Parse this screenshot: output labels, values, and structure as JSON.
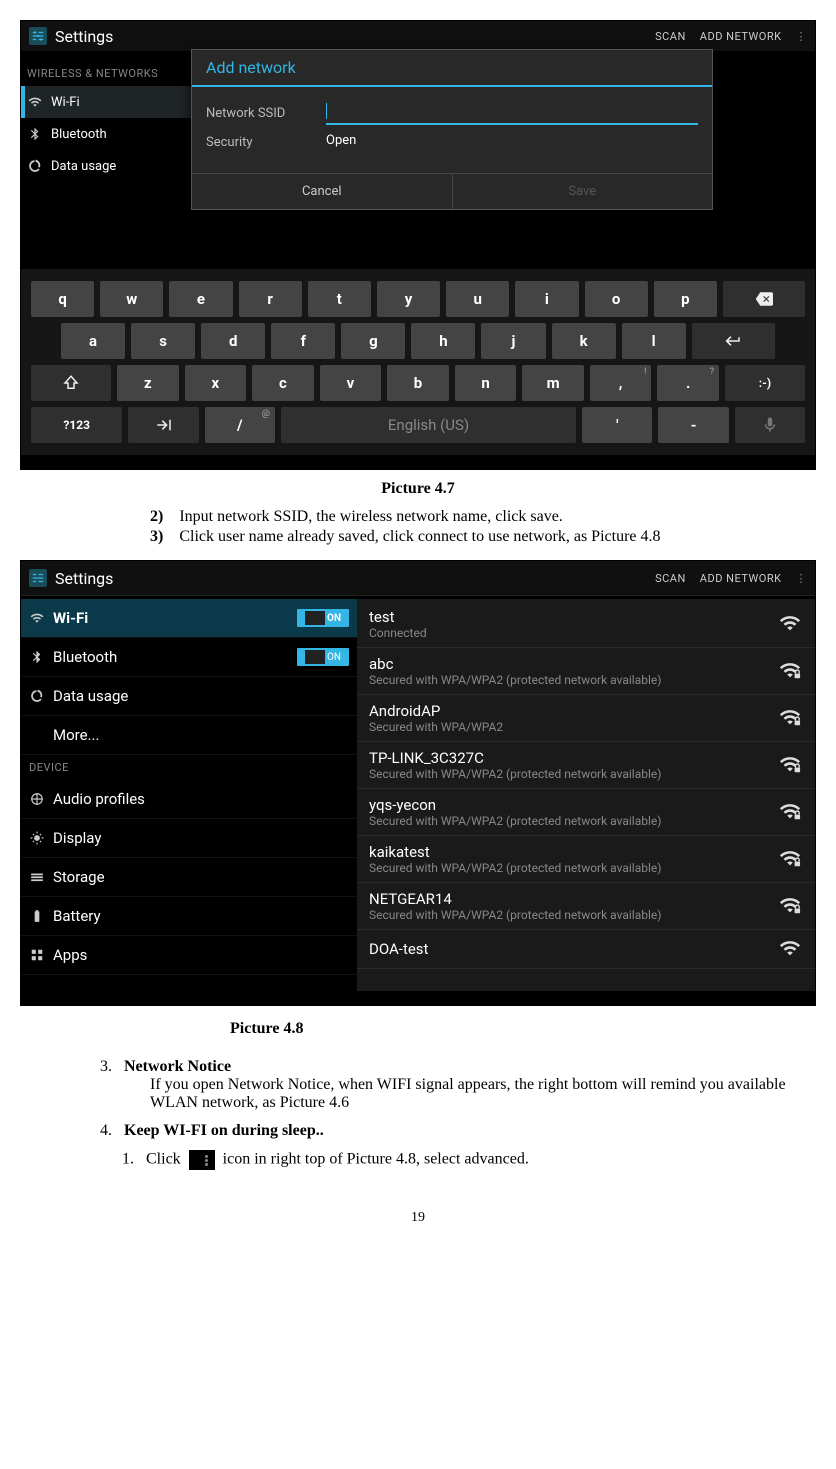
{
  "screenshot1": {
    "app_title": "Settings",
    "header_actions": {
      "scan": "SCAN",
      "add": "ADD NETWORK"
    },
    "sidebar": {
      "section": "WIRELESS & NETWORKS",
      "wifi": "Wi-Fi",
      "bluetooth": "Bluetooth",
      "data_usage": "Data usage"
    },
    "dialog": {
      "title": "Add network",
      "ssid_label": "Network SSID",
      "ssid_value": "",
      "security_label": "Security",
      "security_value": "Open",
      "cancel": "Cancel",
      "save": "Save"
    },
    "keyboard": {
      "row1": [
        "q",
        "w",
        "e",
        "r",
        "t",
        "y",
        "u",
        "i",
        "o",
        "p"
      ],
      "row2": [
        "a",
        "s",
        "d",
        "f",
        "g",
        "h",
        "j",
        "k",
        "l"
      ],
      "row3": [
        "z",
        "x",
        "c",
        "v",
        "b",
        "n",
        "m",
        ",",
        "."
      ],
      "sym_key": "?123",
      "slash_key": "/",
      "slash_alt": "@",
      "space": "English (US)",
      "apos": "'",
      "dash": "-",
      "comma_alt": "!",
      "dot_alt": "?",
      "smiley": ":-)"
    }
  },
  "doc1": {
    "caption": "Picture 4.7",
    "step2_num": "2)",
    "step2": "Input network SSID, the wireless network name, click save.",
    "step3_num": "3)",
    "step3": "Click user name already saved, click connect to use network, as Picture 4.8"
  },
  "screenshot2": {
    "app_title": "Settings",
    "header_actions": {
      "scan": "SCAN",
      "add": "ADD NETWORK"
    },
    "sidebar": {
      "wifi": "Wi-Fi",
      "wifi_toggle": "ON",
      "bluetooth": "Bluetooth",
      "bt_toggle": "ON",
      "data_usage": "Data usage",
      "more": "More...",
      "device_section": "DEVICE",
      "audio": "Audio profiles",
      "display": "Display",
      "storage": "Storage",
      "battery": "Battery",
      "apps": "Apps"
    },
    "networks": [
      {
        "name": "test",
        "sub": "Connected",
        "lock": false
      },
      {
        "name": "abc",
        "sub": "Secured with WPA/WPA2 (protected network available)",
        "lock": true
      },
      {
        "name": "AndroidAP",
        "sub": "Secured with WPA/WPA2",
        "lock": true
      },
      {
        "name": "TP-LINK_3C327C",
        "sub": "Secured with WPA/WPA2 (protected network available)",
        "lock": true
      },
      {
        "name": "yqs-yecon",
        "sub": "Secured with WPA/WPA2 (protected network available)",
        "lock": true
      },
      {
        "name": "kaikatest",
        "sub": "Secured with WPA/WPA2 (protected network available)",
        "lock": true
      },
      {
        "name": "NETGEAR14",
        "sub": "Secured with WPA/WPA2 (protected network available)",
        "lock": true
      },
      {
        "name": "DOA-test",
        "sub": "",
        "lock": false
      }
    ]
  },
  "doc2": {
    "caption": "Picture 4.8",
    "item3_num": "3.",
    "item3_title": "Network Notice",
    "item3_body": "If you open Network Notice, when WIFI signal appears, the right bottom will remind you available WLAN network, as Picture 4.6",
    "item4_num": "4.",
    "item4_title": "Keep WI-FI on during sleep..",
    "sub1_num": "1.",
    "sub1_pre": "Click",
    "sub1_post": "icon in right top of Picture 4.8, select",
    "sub1_bold": "advanced",
    "sub1_end": "."
  },
  "page_number": "19"
}
